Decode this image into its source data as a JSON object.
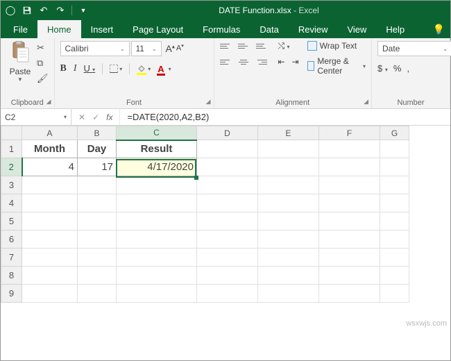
{
  "titlebar": {
    "filename": "DATE Function.xlsx",
    "app": "Excel"
  },
  "tabs": {
    "file": "File",
    "home": "Home",
    "insert": "Insert",
    "page_layout": "Page Layout",
    "formulas": "Formulas",
    "data": "Data",
    "review": "Review",
    "view": "View",
    "help": "Help"
  },
  "ribbon": {
    "clipboard": {
      "label": "Clipboard",
      "paste": "Paste"
    },
    "font": {
      "label": "Font",
      "name": "Calibri",
      "size": "11",
      "bold": "B",
      "italic": "I",
      "underline": "U",
      "grow": "A",
      "shrink": "A",
      "color_glyph": "A"
    },
    "alignment": {
      "label": "Alignment",
      "wrap": "Wrap Text",
      "merge": "Merge & Center"
    },
    "number": {
      "label": "Number",
      "format": "Date",
      "currency": "$",
      "percent": "%",
      "comma": ","
    }
  },
  "namebox": "C2",
  "formula": "=DATE(2020,A2,B2)",
  "columns": [
    "A",
    "B",
    "C",
    "D",
    "E",
    "F",
    "G"
  ],
  "rows": [
    "1",
    "2",
    "3",
    "4",
    "5",
    "6",
    "7",
    "8",
    "9"
  ],
  "cells": {
    "A1": "Month",
    "B1": "Day",
    "C1": "Result",
    "A2": "4",
    "B2": "17",
    "C2": "4/17/2020"
  },
  "watermark": "wsxwjs.com"
}
